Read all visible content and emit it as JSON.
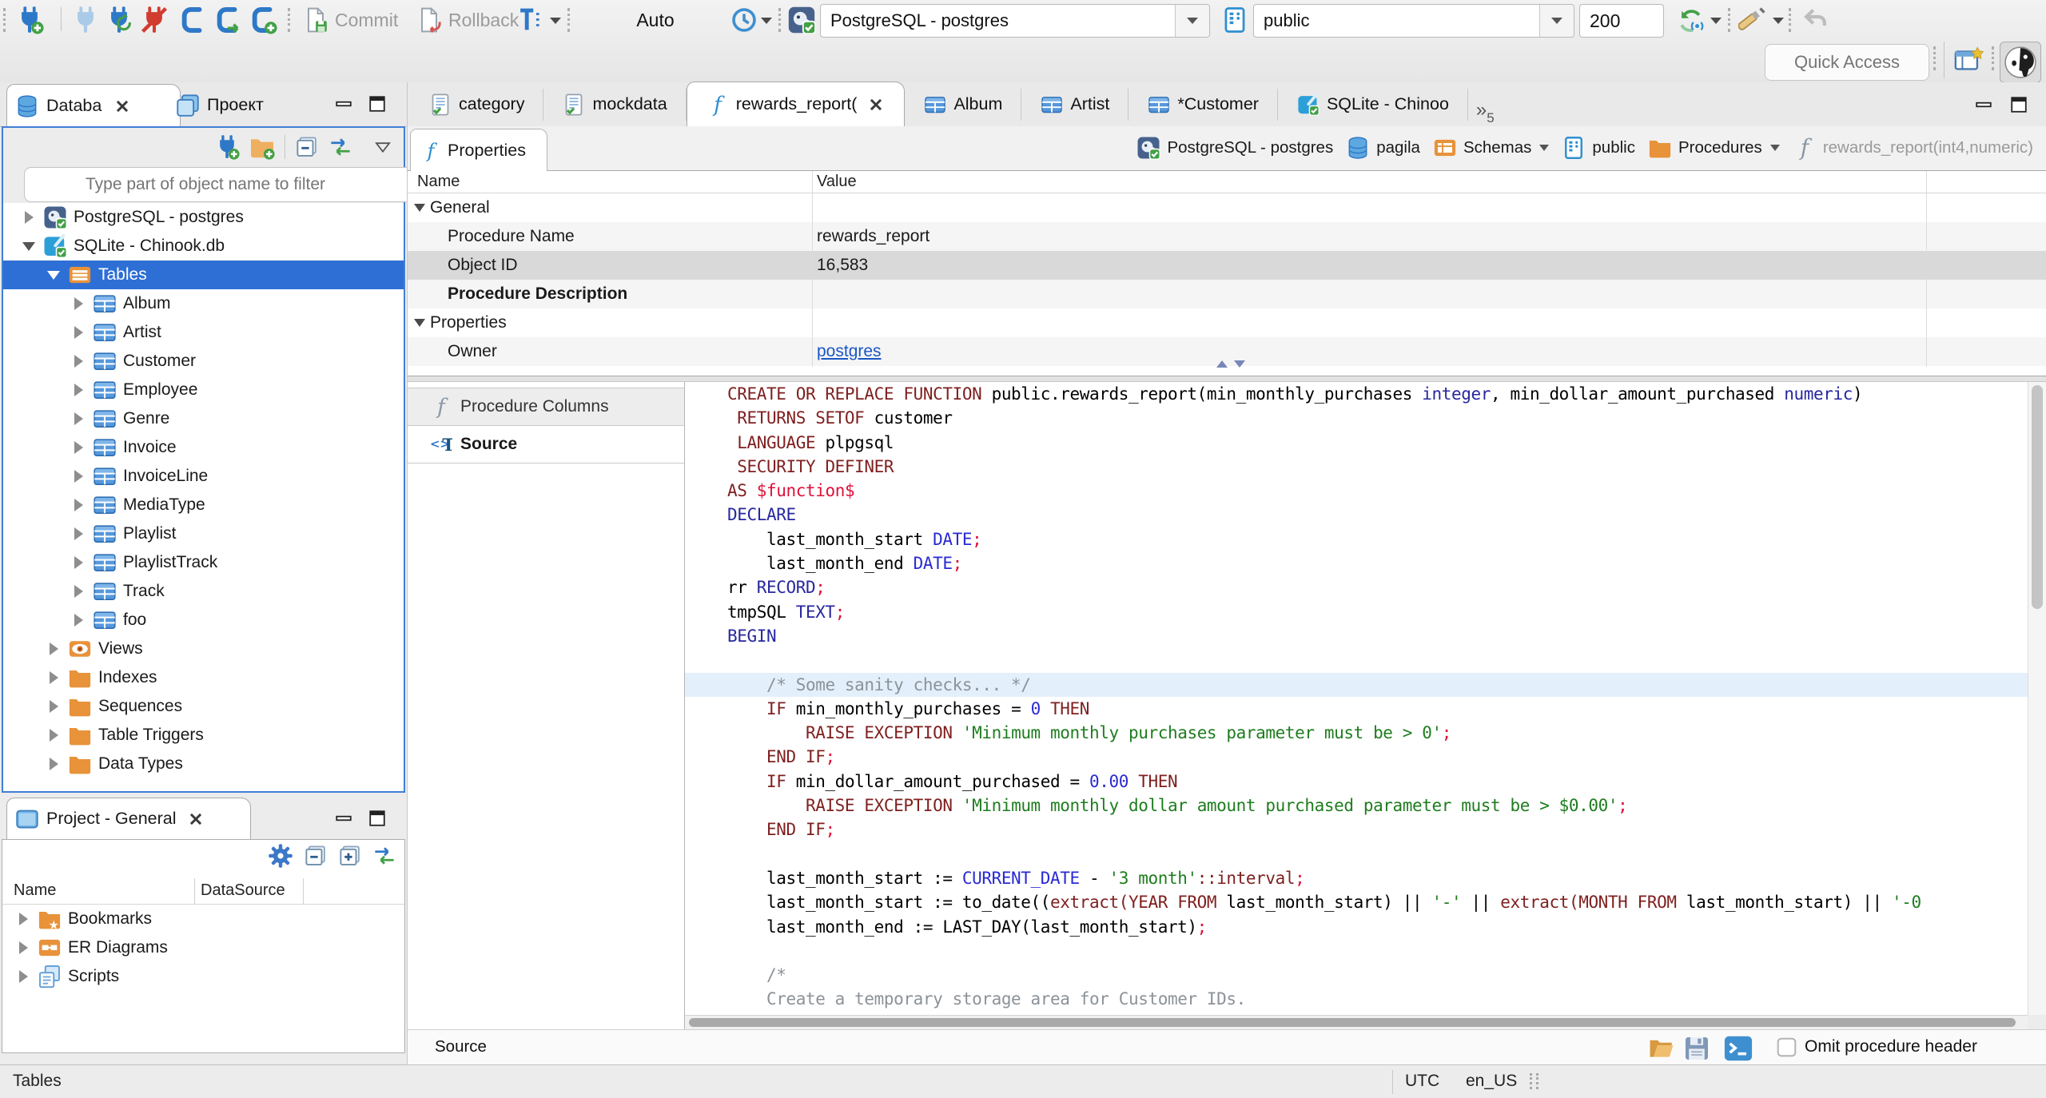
{
  "toolbar": {
    "commit": "Commit",
    "rollback": "Rollback",
    "auto": "Auto",
    "connection": "PostgreSQL - postgres",
    "schema": "public",
    "fetch_size": "200",
    "quick_access": "Quick Access"
  },
  "sidebar": {
    "tabs": [
      {
        "label": "Databa",
        "icon": "db-stack",
        "active": true,
        "closable": true
      },
      {
        "label": "Проект",
        "icon": "windows-stack"
      }
    ],
    "filter_placeholder": "Type part of object name to filter",
    "tree": [
      {
        "label": "PostgreSQL - postgres",
        "icon": "pg-conn",
        "level": 0,
        "arrow": "c"
      },
      {
        "label": "SQLite - Chinook.db",
        "icon": "sqlite-conn",
        "level": 0,
        "arrow": "e"
      },
      {
        "label": "Tables",
        "icon": "folder-table",
        "level": 1,
        "arrow": "e",
        "selected": true
      },
      {
        "label": "Album",
        "icon": "table",
        "level": 2,
        "arrow": "c"
      },
      {
        "label": "Artist",
        "icon": "table",
        "level": 2,
        "arrow": "c"
      },
      {
        "label": "Customer",
        "icon": "table",
        "level": 2,
        "arrow": "c"
      },
      {
        "label": "Employee",
        "icon": "table",
        "level": 2,
        "arrow": "c"
      },
      {
        "label": "Genre",
        "icon": "table",
        "level": 2,
        "arrow": "c"
      },
      {
        "label": "Invoice",
        "icon": "table",
        "level": 2,
        "arrow": "c"
      },
      {
        "label": "InvoiceLine",
        "icon": "table",
        "level": 2,
        "arrow": "c"
      },
      {
        "label": "MediaType",
        "icon": "table",
        "level": 2,
        "arrow": "c"
      },
      {
        "label": "Playlist",
        "icon": "table",
        "level": 2,
        "arrow": "c"
      },
      {
        "label": "PlaylistTrack",
        "icon": "table",
        "level": 2,
        "arrow": "c"
      },
      {
        "label": "Track",
        "icon": "table",
        "level": 2,
        "arrow": "c"
      },
      {
        "label": "foo",
        "icon": "table",
        "level": 2,
        "arrow": "c"
      },
      {
        "label": "Views",
        "icon": "eye-view",
        "level": 1,
        "arrow": "c"
      },
      {
        "label": "Indexes",
        "icon": "folder",
        "level": 1,
        "arrow": "c"
      },
      {
        "label": "Sequences",
        "icon": "folder",
        "level": 1,
        "arrow": "c"
      },
      {
        "label": "Table Triggers",
        "icon": "folder",
        "level": 1,
        "arrow": "c"
      },
      {
        "label": "Data Types",
        "icon": "folder",
        "level": 1,
        "arrow": "c"
      }
    ]
  },
  "project_panel": {
    "title": "Project - General",
    "columns": [
      "Name",
      "DataSource"
    ],
    "items": [
      {
        "label": "Bookmarks",
        "icon": "folder-star"
      },
      {
        "label": "ER Diagrams",
        "icon": "er-diagram"
      },
      {
        "label": "Scripts",
        "icon": "scripts"
      }
    ]
  },
  "editor": {
    "tabs": [
      {
        "label": "category",
        "icon": "sqlfile"
      },
      {
        "label": "mockdata",
        "icon": "sqlfile"
      },
      {
        "label": "rewards_report(",
        "icon": "f-blue",
        "active": true,
        "closable": true
      },
      {
        "label": "Album",
        "icon": "table"
      },
      {
        "label": "Artist",
        "icon": "table"
      },
      {
        "label": "*Customer",
        "icon": "table"
      },
      {
        "label": "SQLite - Chinoo",
        "icon": "sqlite-conn"
      }
    ],
    "overflow": {
      "symbol": "»",
      "count": "5"
    },
    "properties_tab": "Properties",
    "breadcrumb": [
      {
        "label": "PostgreSQL - postgres",
        "icon": "pg-conn"
      },
      {
        "label": "pagila",
        "icon": "db-stack"
      },
      {
        "label": "Schemas",
        "icon": "schemas-folder",
        "dropdown": true
      },
      {
        "label": "public",
        "icon": "schema-card"
      },
      {
        "label": "Procedures",
        "icon": "folder",
        "dropdown": true
      },
      {
        "label": "rewards_report(int4,numeric)",
        "icon": "f-gray",
        "muted": true
      }
    ],
    "grid": {
      "name_col": "Name",
      "value_col": "Value",
      "rows": [
        {
          "type": "section",
          "name": "General",
          "value": ""
        },
        {
          "type": "prop",
          "name": "Procedure Name",
          "value": "rewards_report"
        },
        {
          "type": "prop",
          "name": "Object ID",
          "value": "16,583",
          "selected": true
        },
        {
          "type": "prop",
          "name": "Procedure Description",
          "value": "",
          "bold": true
        },
        {
          "type": "section",
          "name": "Properties",
          "value": ""
        },
        {
          "type": "prop",
          "name": "Owner",
          "value": "postgres",
          "link": true
        }
      ]
    },
    "subtabs": [
      {
        "label": "Procedure Columns",
        "icon": "f-gray"
      },
      {
        "label": "Source",
        "icon": "src-code",
        "active": true
      }
    ],
    "code": [
      {
        "tokens": [
          {
            "t": "CREATE OR REPLACE FUNCTION",
            "c": "k"
          },
          {
            "t": " public.rewards_report(min_monthly_purchases ",
            "c": "i"
          },
          {
            "t": "integer",
            "c": "t"
          },
          {
            "t": ", min_dollar_amount_purchased ",
            "c": "i"
          },
          {
            "t": "numeric",
            "c": "t"
          },
          {
            "t": ")",
            "c": "i"
          }
        ]
      },
      {
        "tokens": [
          {
            "t": " ",
            "c": "i"
          },
          {
            "t": "RETURNS SETOF",
            "c": "k"
          },
          {
            "t": " customer",
            "c": "i"
          }
        ]
      },
      {
        "tokens": [
          {
            "t": " ",
            "c": "i"
          },
          {
            "t": "LANGUAGE",
            "c": "k"
          },
          {
            "t": " plpgsql",
            "c": "i"
          }
        ]
      },
      {
        "tokens": [
          {
            "t": " ",
            "c": "i"
          },
          {
            "t": "SECURITY DEFINER",
            "c": "k"
          }
        ]
      },
      {
        "tokens": [
          {
            "t": "AS",
            "c": "k"
          },
          {
            "t": " ",
            "c": "i"
          },
          {
            "t": "$function$",
            "c": "d"
          }
        ]
      },
      {
        "tokens": [
          {
            "t": "DECLARE",
            "c": "t"
          }
        ]
      },
      {
        "tokens": [
          {
            "t": "    last_month_start ",
            "c": "i"
          },
          {
            "t": "DATE",
            "c": "b"
          },
          {
            "t": ";",
            "c": "p"
          }
        ]
      },
      {
        "tokens": [
          {
            "t": "    last_month_end ",
            "c": "i"
          },
          {
            "t": "DATE",
            "c": "b"
          },
          {
            "t": ";",
            "c": "p"
          }
        ]
      },
      {
        "tokens": [
          {
            "t": "rr ",
            "c": "i"
          },
          {
            "t": "RECORD",
            "c": "t"
          },
          {
            "t": ";",
            "c": "p"
          }
        ]
      },
      {
        "tokens": [
          {
            "t": "tmpSQL ",
            "c": "i"
          },
          {
            "t": "TEXT",
            "c": "t"
          },
          {
            "t": ";",
            "c": "p"
          }
        ]
      },
      {
        "tokens": [
          {
            "t": "BEGIN",
            "c": "t"
          }
        ]
      },
      {
        "tokens": []
      },
      {
        "hl": true,
        "tokens": [
          {
            "t": "    ",
            "c": "i"
          },
          {
            "t": "/* Some sanity checks... */",
            "c": "c"
          }
        ]
      },
      {
        "tokens": [
          {
            "t": "    ",
            "c": "i"
          },
          {
            "t": "IF",
            "c": "k"
          },
          {
            "t": " min_monthly_purchases = ",
            "c": "i"
          },
          {
            "t": "0",
            "c": "b"
          },
          {
            "t": " ",
            "c": "i"
          },
          {
            "t": "THEN",
            "c": "k"
          }
        ]
      },
      {
        "tokens": [
          {
            "t": "        ",
            "c": "i"
          },
          {
            "t": "RAISE EXCEPTION",
            "c": "k"
          },
          {
            "t": " ",
            "c": "i"
          },
          {
            "t": "'Minimum monthly purchases parameter must be > 0'",
            "c": "s"
          },
          {
            "t": ";",
            "c": "p"
          }
        ]
      },
      {
        "tokens": [
          {
            "t": "    ",
            "c": "i"
          },
          {
            "t": "END IF",
            "c": "k"
          },
          {
            "t": ";",
            "c": "p"
          }
        ]
      },
      {
        "tokens": [
          {
            "t": "    ",
            "c": "i"
          },
          {
            "t": "IF",
            "c": "k"
          },
          {
            "t": " min_dollar_amount_purchased = ",
            "c": "i"
          },
          {
            "t": "0.00",
            "c": "b"
          },
          {
            "t": " ",
            "c": "i"
          },
          {
            "t": "THEN",
            "c": "k"
          }
        ]
      },
      {
        "tokens": [
          {
            "t": "        ",
            "c": "i"
          },
          {
            "t": "RAISE EXCEPTION",
            "c": "k"
          },
          {
            "t": " ",
            "c": "i"
          },
          {
            "t": "'Minimum monthly dollar amount purchased parameter must be > $0.00'",
            "c": "s"
          },
          {
            "t": ";",
            "c": "p"
          }
        ]
      },
      {
        "tokens": [
          {
            "t": "    ",
            "c": "i"
          },
          {
            "t": "END IF",
            "c": "k"
          },
          {
            "t": ";",
            "c": "p"
          }
        ]
      },
      {
        "tokens": []
      },
      {
        "tokens": [
          {
            "t": "    last_month_start := ",
            "c": "i"
          },
          {
            "t": "CURRENT_DATE",
            "c": "b"
          },
          {
            "t": " - ",
            "c": "i"
          },
          {
            "t": "'3 month'",
            "c": "s"
          },
          {
            "t": "::interval",
            "c": "k"
          },
          {
            "t": ";",
            "c": "p"
          }
        ]
      },
      {
        "tokens": [
          {
            "t": "    last_month_start := to_date((",
            "c": "i"
          },
          {
            "t": "extract(YEAR FROM",
            "c": "k"
          },
          {
            "t": " last_month_start) || ",
            "c": "i"
          },
          {
            "t": "'-'",
            "c": "s"
          },
          {
            "t": " || ",
            "c": "i"
          },
          {
            "t": "extract(MONTH FROM",
            "c": "k"
          },
          {
            "t": " last_month_start) || ",
            "c": "i"
          },
          {
            "t": "'-0",
            "c": "s"
          }
        ]
      },
      {
        "tokens": [
          {
            "t": "    last_month_end := LAST_DAY(last_month_start)",
            "c": "i"
          },
          {
            "t": ";",
            "c": "p"
          }
        ]
      },
      {
        "tokens": []
      },
      {
        "tokens": [
          {
            "t": "    ",
            "c": "i"
          },
          {
            "t": "/*",
            "c": "c"
          }
        ]
      },
      {
        "tokens": [
          {
            "t": "    ",
            "c": "i"
          },
          {
            "t": "Create a temporary storage area for Customer IDs.",
            "c": "c"
          }
        ]
      },
      {
        "tokens": [
          {
            "t": "    ",
            "c": "i"
          },
          {
            "t": "*/",
            "c": "c"
          }
        ]
      }
    ],
    "footer": {
      "label": "Source",
      "omit": "Omit procedure header"
    }
  },
  "statusbar": {
    "left": "Tables",
    "utc": "UTC",
    "locale": "en_US"
  }
}
